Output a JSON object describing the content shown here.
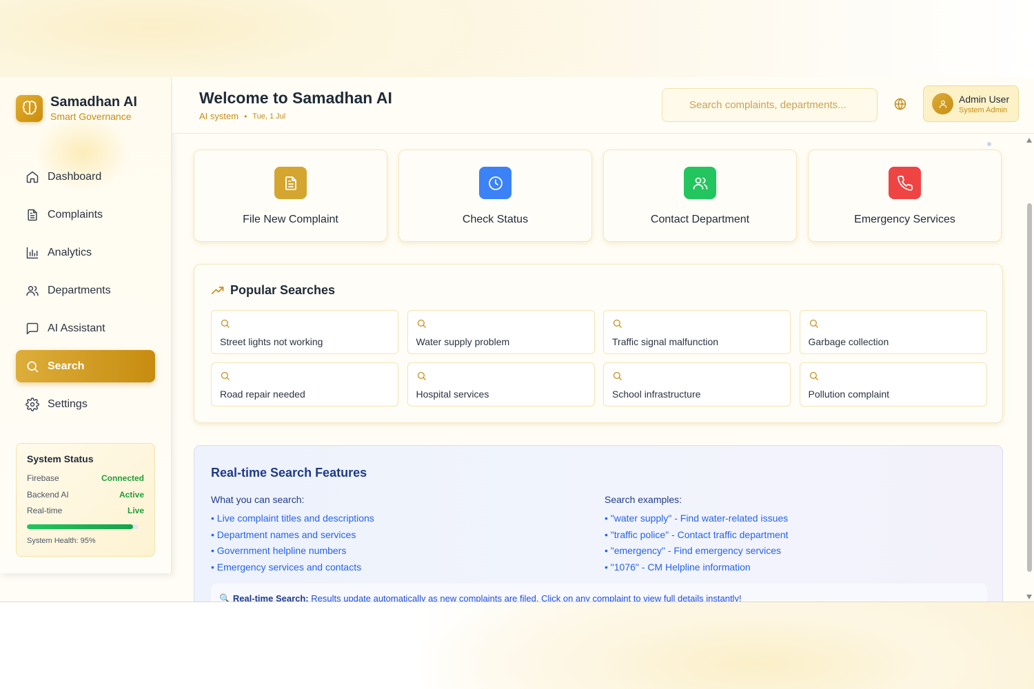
{
  "brand": {
    "title": "Samadhan AI",
    "subtitle": "Smart Governance"
  },
  "sidebar": {
    "items": [
      {
        "label": "Dashboard",
        "icon": "home-icon"
      },
      {
        "label": "Complaints",
        "icon": "file-text-icon"
      },
      {
        "label": "Analytics",
        "icon": "bar-chart-icon"
      },
      {
        "label": "Departments",
        "icon": "users-icon"
      },
      {
        "label": "AI Assistant",
        "icon": "message-square-icon"
      },
      {
        "label": "Search",
        "icon": "search-icon",
        "active": true
      },
      {
        "label": "Settings",
        "icon": "gear-icon"
      }
    ]
  },
  "system_status": {
    "title": "System Status",
    "rows": [
      {
        "label": "Firebase",
        "value": "Connected"
      },
      {
        "label": "Backend AI",
        "value": "Active"
      },
      {
        "label": "Real-time",
        "value": "Live"
      }
    ],
    "health_percent": 95,
    "health_text": "System Health: 95%"
  },
  "header": {
    "title": "Welcome to Samadhan AI",
    "system_label": "AI system",
    "date": "Tue, 1 Jul",
    "search_placeholder": "Search complaints, departments...",
    "user_name": "Admin User",
    "user_role": "System Admin"
  },
  "actions": [
    {
      "label": "File New Complaint",
      "icon": "file-text-icon",
      "color": "#d4a52f"
    },
    {
      "label": "Check Status",
      "icon": "clock-icon",
      "color": "#3b82f6"
    },
    {
      "label": "Contact Department",
      "icon": "users-icon",
      "color": "#22c55e"
    },
    {
      "label": "Emergency Services",
      "icon": "phone-icon",
      "color": "#ef4444"
    }
  ],
  "popular": {
    "title": "Popular Searches",
    "items": [
      "Street lights not working",
      "Water supply problem",
      "Traffic signal malfunction",
      "Garbage collection",
      "Road repair needed",
      "Hospital services",
      "School infrastructure",
      "Pollution complaint"
    ]
  },
  "features": {
    "title": "Real-time Search Features",
    "left_head": "What you can search:",
    "left_items": [
      "• Live complaint titles and descriptions",
      "• Department names and services",
      "• Government helpline numbers",
      "• Emergency services and contacts"
    ],
    "right_head": "Search examples:",
    "right_items": [
      "• \"water supply\" - Find water-related issues",
      "• \"traffic police\" - Contact traffic department",
      "• \"emergency\" - Find emergency services",
      "• \"1076\" - CM Helpline information"
    ],
    "note_bold": "Real-time Search:",
    "note_text": " Results update automatically as new complaints are filed. Click on any complaint to view full details instantly!"
  },
  "colors": {
    "accent": "#c98d0a",
    "success": "#1f9d3a",
    "info": "#1e3a8a"
  }
}
